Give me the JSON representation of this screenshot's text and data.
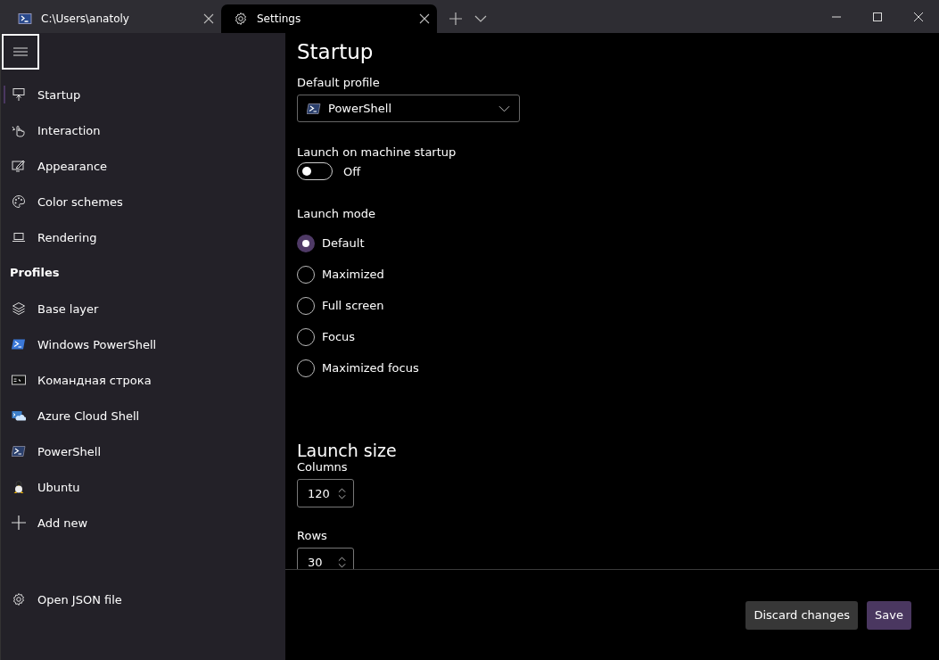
{
  "tabs": [
    {
      "label": "C:\\Users\\anatoly",
      "kind": "powershell",
      "selected": false
    },
    {
      "label": "Settings",
      "kind": "gear",
      "selected": true
    }
  ],
  "sidebar": {
    "items": [
      {
        "label": "Startup",
        "kind": "startup",
        "selected": true
      },
      {
        "label": "Interaction",
        "kind": "hand",
        "selected": false
      },
      {
        "label": "Appearance",
        "kind": "appearance",
        "selected": false
      },
      {
        "label": "Color schemes",
        "kind": "palette",
        "selected": false
      },
      {
        "label": "Rendering",
        "kind": "laptop",
        "selected": false
      }
    ],
    "profiles_header": "Profiles",
    "profiles": [
      {
        "label": "Base layer",
        "kind": "layers",
        "selected": false
      },
      {
        "label": "Windows PowerShell",
        "kind": "powershell-blue",
        "selected": false
      },
      {
        "label": "Командная строка",
        "kind": "cmd",
        "selected": false
      },
      {
        "label": "Azure Cloud Shell",
        "kind": "azure",
        "selected": false
      },
      {
        "label": "PowerShell",
        "kind": "powershell",
        "selected": false
      },
      {
        "label": "Ubuntu",
        "kind": "penguin",
        "selected": false
      },
      {
        "label": "Add new",
        "kind": "plus",
        "selected": false
      }
    ],
    "footer_item": {
      "label": "Open JSON file",
      "kind": "gear"
    }
  },
  "page": {
    "title": "Startup",
    "default_profile": {
      "label": "Default profile",
      "value": "PowerShell"
    },
    "launch_on_startup": {
      "label": "Launch on machine startup",
      "on": false,
      "state_text": "Off"
    },
    "launch_mode": {
      "label": "Launch mode",
      "options": [
        {
          "label": "Default",
          "selected": true
        },
        {
          "label": "Maximized",
          "selected": false
        },
        {
          "label": "Full screen",
          "selected": false
        },
        {
          "label": "Focus",
          "selected": false
        },
        {
          "label": "Maximized focus",
          "selected": false
        }
      ]
    },
    "launch_size": {
      "title": "Launch size",
      "columns": {
        "label": "Columns",
        "value": "120"
      },
      "rows": {
        "label": "Rows",
        "value": "30"
      }
    }
  },
  "buttons": [
    {
      "label": "Discard changes",
      "kind": "secondary"
    },
    {
      "label": "Save",
      "kind": "primary"
    }
  ]
}
